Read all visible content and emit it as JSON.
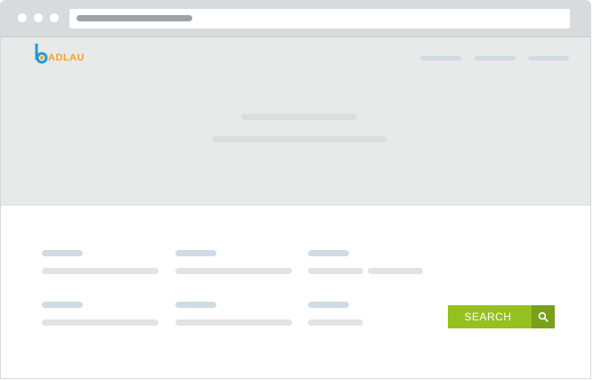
{
  "logo": {
    "text": "ADLAU",
    "mark": "b"
  },
  "search": {
    "button_label": "SEARCH",
    "icon": "magnifier-icon"
  },
  "colors": {
    "accent_green": "#94c11f",
    "accent_green_dark": "#78a01a",
    "logo_orange": "#f2a51c",
    "logo_blue": "#1e9bd7"
  }
}
